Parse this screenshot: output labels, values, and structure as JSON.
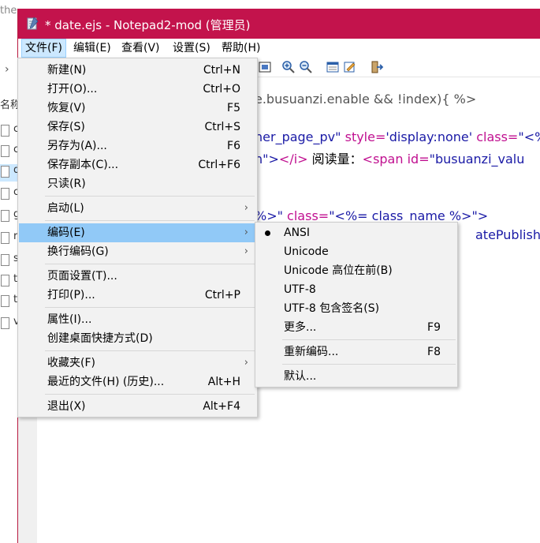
{
  "background": {
    "top_text": "the",
    "label": "名称",
    "file_chars": [
      "c",
      "c",
      "d",
      "c",
      "g",
      "r",
      "s",
      "t",
      "t",
      "v"
    ]
  },
  "window": {
    "title": "* date.ejs - Notepad2-mod (管理员)",
    "accent_color": "#c3134c"
  },
  "menubar": {
    "items": [
      "文件(F)",
      "编辑(E)",
      "查看(V)",
      "设置(S)",
      "帮助(H)"
    ]
  },
  "editor": {
    "lines": [
      {
        "parts": [
          "e.busuanzi.enable && !index){ %>"
        ]
      },
      {
        "parts": [
          "her_page_pv\"",
          " style=",
          "'display:none'",
          " class=",
          "\"<%"
        ]
      },
      {
        "parts": [
          "n\">",
          "</i>",
          " 阅读量：",
          "<span",
          " id=",
          "\"busuanzi_valu"
        ]
      },
      {
        "parts": [
          "%>\"",
          " class=",
          "\"<%= class_name %>\">"
        ]
      },
      {
        "parts": [
          "atePublished"
        ]
      }
    ]
  },
  "file_menu": {
    "items": [
      {
        "label": "新建(N)",
        "shortcut": "Ctrl+N"
      },
      {
        "label": "打开(O)...",
        "shortcut": "Ctrl+O"
      },
      {
        "label": "恢复(V)",
        "shortcut": "F5"
      },
      {
        "label": "保存(S)",
        "shortcut": "Ctrl+S"
      },
      {
        "label": "另存为(A)...",
        "shortcut": "F6"
      },
      {
        "label": "保存副本(C)...",
        "shortcut": "Ctrl+F6"
      },
      {
        "label": "只读(R)",
        "shortcut": ""
      },
      {
        "label": "启动(L)",
        "shortcut": ""
      },
      {
        "label": "编码(E)",
        "shortcut": ""
      },
      {
        "label": "换行编码(G)",
        "shortcut": ""
      },
      {
        "label": "页面设置(T)...",
        "shortcut": ""
      },
      {
        "label": "打印(P)...",
        "shortcut": "Ctrl+P"
      },
      {
        "label": "属性(I)...",
        "shortcut": ""
      },
      {
        "label": "创建桌面快捷方式(D)",
        "shortcut": ""
      },
      {
        "label": "收藏夹(F)",
        "shortcut": ""
      },
      {
        "label": "最近的文件(H) (历史)...",
        "shortcut": "Alt+H"
      },
      {
        "label": "退出(X)",
        "shortcut": "Alt+F4"
      }
    ]
  },
  "encoding_menu": {
    "items": [
      {
        "label": "ANSI",
        "shortcut": "",
        "checked": true
      },
      {
        "label": "Unicode",
        "shortcut": ""
      },
      {
        "label": "Unicode 高位在前(B)",
        "shortcut": ""
      },
      {
        "label": "UTF-8",
        "shortcut": ""
      },
      {
        "label": "UTF-8 包含签名(S)",
        "shortcut": ""
      },
      {
        "label": "更多...",
        "shortcut": "F9"
      },
      {
        "label": "重新编码...",
        "shortcut": "F8"
      },
      {
        "label": "默认...",
        "shortcut": ""
      }
    ]
  }
}
